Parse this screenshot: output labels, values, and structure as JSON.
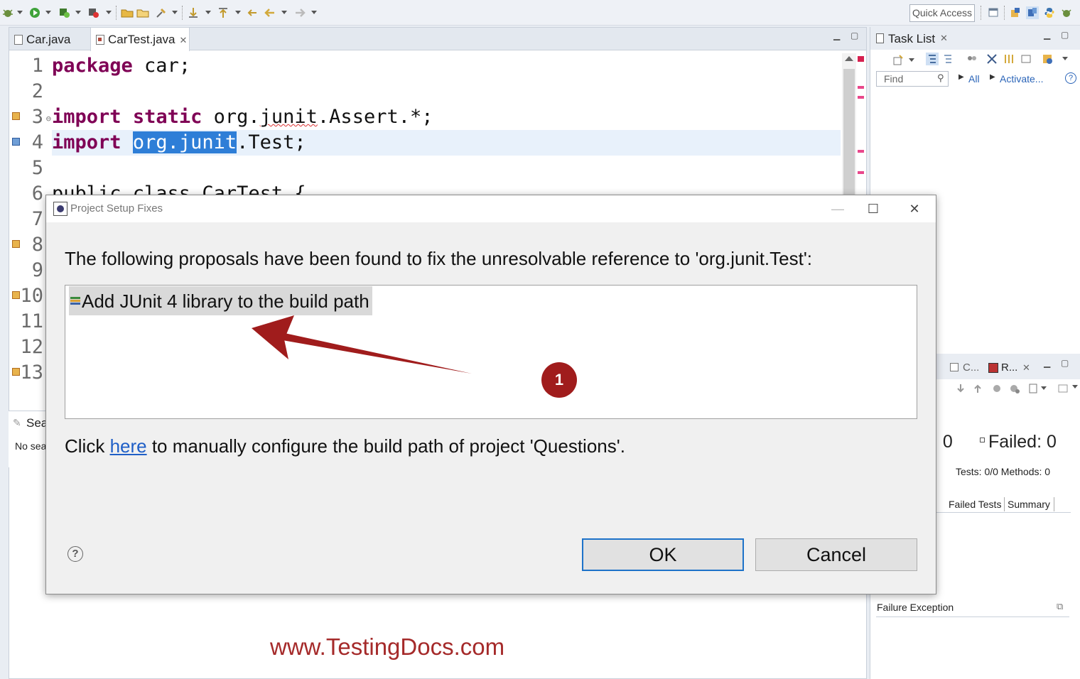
{
  "toolbar": {
    "quick_access": "Quick Access"
  },
  "editor": {
    "tabs": [
      {
        "label": "Car.java",
        "active": false
      },
      {
        "label": "CarTest.java",
        "active": true
      }
    ],
    "line_numbers": [
      "1",
      "2",
      "3",
      "4",
      "5",
      "6",
      "7",
      "8",
      "9",
      "10",
      "11",
      "12",
      "13"
    ],
    "code": {
      "l1_kw": "package",
      "l1_rest": " car;",
      "l3_kw1": "import",
      "l3_kw2": "static",
      "l3_a": " org.",
      "l3_b": "junit",
      "l3_c": ".Assert.*;",
      "l4_kw": "import",
      "l4_sel": "org.junit",
      "l4_rest": ".Test;",
      "l6": "public class CarTest {"
    }
  },
  "search_view": {
    "title": "Sea",
    "message": "No sea"
  },
  "tasklist": {
    "title": "Task List",
    "find_placeholder": "Find",
    "all_link": "All",
    "activate_link": "Activate..."
  },
  "junit": {
    "tab_c": "C...",
    "tab_r": "R...",
    "errors_label": ": 0",
    "failed_label": "Failed: 0",
    "tests_methods": "Tests: 0/0  Methods: 0",
    "failed_tests_tab": "Failed Tests",
    "summary_tab": "Summary",
    "failure_exception": "Failure Exception"
  },
  "dialog": {
    "title": "Project Setup Fixes",
    "message": "The following proposals have been found to fix the unresolvable reference to 'org.junit.Test':",
    "proposal": "Add JUnit 4 library to the build path",
    "config_before": "Click ",
    "config_link": "here",
    "config_after": " to manually configure the build path of project 'Questions'.",
    "ok_label": "OK",
    "cancel_label": "Cancel",
    "help_glyph": "?",
    "minimize_glyph": "—",
    "maximize_glyph": "☐",
    "close_glyph": "✕"
  },
  "annotation": {
    "step_number": "1",
    "arrow_color": "#a01c1c"
  },
  "watermark": "www.TestingDocs.com",
  "colors": {
    "keyword": "#7f0055",
    "selection": "#2e7ed7",
    "link": "#1f5fc7",
    "watermark": "#a52a2a"
  }
}
